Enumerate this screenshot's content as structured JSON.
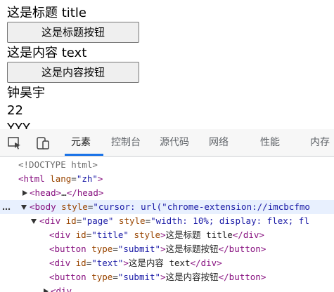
{
  "preview": {
    "title_text": "这是标题 title",
    "title_button": "这是标题按钮",
    "content_text": "这是内容 text",
    "content_button": "这是内容按钮",
    "name": "钟昊宇",
    "age": "22",
    "partial": "YYY"
  },
  "devtools": {
    "tabs": [
      "元素",
      "控制台",
      "源代码",
      "网络",
      "性能",
      "内存"
    ],
    "active_tab": "元素",
    "accent_color": "#1a73e8",
    "dom": {
      "doctype": "<!DOCTYPE html>",
      "html_open": "<html",
      "html_attr_name": "lang",
      "html_attr_value": "\"zh\"",
      "head_open": "<head>",
      "head_ellipsis": "…",
      "head_close": "</head>",
      "ellipsis_marker": "…",
      "body_open": "<body",
      "body_attr_name": "style",
      "body_attr_value": "\"cursor: url(\"chrome-extension://imcbcfmo",
      "div_page_open": "<div",
      "div_page_id_name": "id",
      "div_page_id_value": "\"page\"",
      "div_page_style_name": "style",
      "div_page_style_value": "\"width: 10%; display: flex; fl",
      "title_div_open": "<div",
      "title_div_id_name": "id",
      "title_div_id_value": "\"title\"",
      "title_div_style_name": "style",
      "title_div_text": "这是标题 title",
      "div_close": "</div>",
      "button_open": "<button",
      "button_type_name": "type",
      "button_type_value": "\"submit\"",
      "title_button_text": "这是标题按钮",
      "button_close": "</button>",
      "text_div_id_value": "\"text\"",
      "text_div_text": "这是内容 text",
      "content_button_text": "这是内容按钮"
    }
  }
}
